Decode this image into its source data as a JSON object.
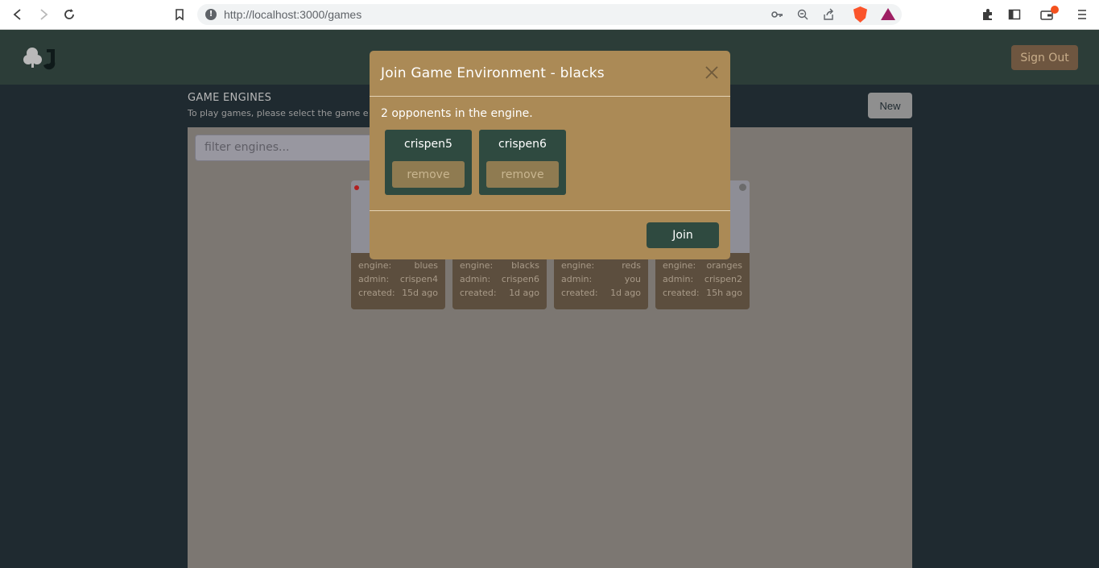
{
  "browser": {
    "url": "http://localhost:3000/games",
    "icons": [
      "back-icon",
      "forward-icon",
      "reload-icon",
      "bookmark-icon",
      "key-icon",
      "zoom-icon",
      "share-icon",
      "brave-icon",
      "bat-icon",
      "extensions-icon",
      "sidebar-icon",
      "wallet-icon",
      "menu-icon"
    ]
  },
  "header": {
    "signout_label": "Sign Out"
  },
  "page": {
    "title": "GAME ENGINES",
    "subtitle": "To play games, please select the game e",
    "new_label": "New",
    "filter_placeholder": "filter engines..."
  },
  "engines": [
    {
      "dot_color": "#b11f1f",
      "engine_label": "engine:",
      "engine": "blues",
      "admin_label": "admin:",
      "admin": "crispen4",
      "created_label": "created:",
      "created": "15d ago"
    },
    {
      "dot_color": "",
      "engine_label": "engine:",
      "engine": "blacks",
      "admin_label": "admin:",
      "admin": "crispen6",
      "created_label": "created:",
      "created": "1d ago"
    },
    {
      "dot_color": "",
      "engine_label": "engine:",
      "engine": "reds",
      "admin_label": "admin:",
      "admin": "you",
      "created_label": "created:",
      "created": "1d ago"
    },
    {
      "dot_color": "#6b6b6b",
      "engine_label": "engine:",
      "engine": "oranges",
      "admin_label": "admin:",
      "admin": "crispen2",
      "created_label": "created:",
      "created": "15h ago"
    }
  ],
  "modal": {
    "title": "Join Game Environment - blacks",
    "close_symbol": "✕",
    "opponents_text": "2 opponents in the engine.",
    "players": [
      {
        "name": "crispen5",
        "remove_label": "remove"
      },
      {
        "name": "crispen6",
        "remove_label": "remove"
      }
    ],
    "join_label": "Join"
  },
  "colors": {
    "header_bg": "#2c3d38",
    "modal_bg": "#ab8a56",
    "player_card_bg": "#2f4a40",
    "join_bg": "#2f4a40"
  }
}
